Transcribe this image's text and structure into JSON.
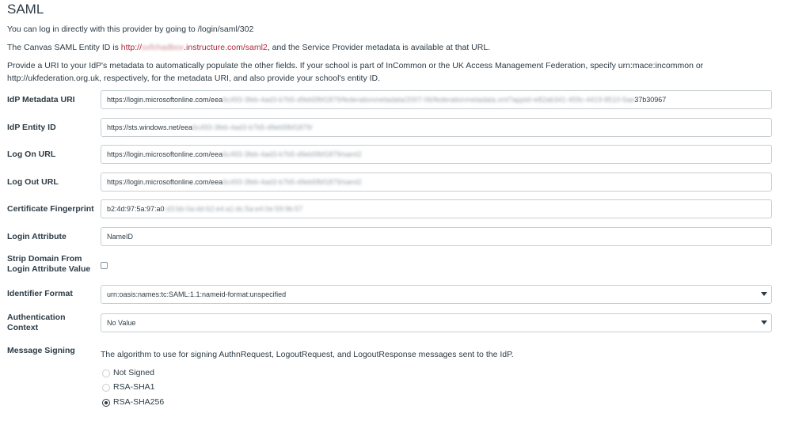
{
  "page": {
    "title": "SAML",
    "intro_direct_login": "You can log in directly with this provider by going to /login/saml/302",
    "entity_id_prefix": "The Canvas SAML Entity ID is ",
    "entity_id_link_scheme": "http://",
    "entity_id_link_blurred": "sxfchadbox",
    "entity_id_link_host": ".instructure.com/saml2",
    "entity_id_suffix": ", and the Service Provider metadata is available at that URL.",
    "metadata_help": "Provide a URI to your IdP's metadata to automatically populate the other fields. If your school is part of InCommon or the UK Access Management Federation, specify urn:mace:incommon or http://ukfederation.org.uk, respectively, for the metadata URI, and also provide your school's entity ID."
  },
  "fields": {
    "idp_metadata_uri": {
      "label": "IdP Metadata URI",
      "value_start": "https://login.microsoftonline.com/eea",
      "value_blurred": "6c493-3feb-4ad3-b7b5-d9eb5fbf1879/federationmetadata/2007-06/federationmetadata.xml?appid=e82ab341-459c-4419-8510-5ae",
      "value_end": "37b30967"
    },
    "idp_entity_id": {
      "label": "IdP Entity ID",
      "value_start": "https://sts.windows.net/eea",
      "value_blurred": "6c493-3feb-4ad3-b7b5-d9eb5fbf1879/"
    },
    "log_on_url": {
      "label": "Log On URL",
      "value_start": "https://login.microsoftonline.com/eea",
      "value_blurred": "6c493-3feb-4ad3-b7b5-d9eb5fbf1879/saml2"
    },
    "log_out_url": {
      "label": "Log Out URL",
      "value_start": "https://login.microsoftonline.com/eea",
      "value_blurred": "6c493-3feb-4ad3-b7b5-d9eb5fbf1879/saml2"
    },
    "certificate_fingerprint": {
      "label": "Certificate Fingerprint",
      "value_start": "b2:4d:97:5a:97:a0",
      "value_blurred": ":d3:bb:0a:dd:62:e4:a1:dc:5a:e4:0e:59:9b:57"
    },
    "login_attribute": {
      "label": "Login Attribute",
      "value": "NameID"
    },
    "strip_domain": {
      "label": "Strip Domain From Login Attribute Value",
      "checked": false
    },
    "identifier_format": {
      "label": "Identifier Format",
      "selected": "urn:oasis:names:tc:SAML:1.1:nameid-format:unspecified"
    },
    "authentication_context": {
      "label": "Authentication Context",
      "selected": "No Value"
    },
    "message_signing": {
      "label": "Message Signing",
      "description": "The algorithm to use for signing AuthnRequest, LogoutRequest, and LogoutResponse messages sent to the IdP.",
      "options": [
        "Not Signed",
        "RSA-SHA1",
        "RSA-SHA256"
      ],
      "selected": "RSA-SHA256"
    }
  }
}
